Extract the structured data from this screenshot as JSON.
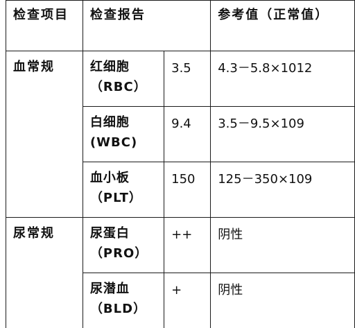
{
  "header": {
    "col1": "检查项目",
    "col2": "检查报告",
    "col3": "参考值（正常值）"
  },
  "groups": [
    {
      "name": "血常规",
      "rows": [
        {
          "item": "红细胞",
          "abbr": "（RBC）",
          "value": "3.5",
          "reference": "4.3－5.8×1012"
        },
        {
          "item": "白细胞",
          "abbr": "(WBC)",
          "value": "9.4",
          "reference": "3.5－9.5×109"
        },
        {
          "item": "血小板",
          "abbr": "（PLT）",
          "value": "150",
          "reference": "125－350×109"
        }
      ]
    },
    {
      "name": "尿常规",
      "rows": [
        {
          "item": "尿蛋白",
          "abbr": "（PRO）",
          "value": "++",
          "reference": "阴性"
        },
        {
          "item": "尿潜血",
          "abbr": "（BLD）",
          "value": "+",
          "reference": "阴性"
        }
      ]
    }
  ]
}
